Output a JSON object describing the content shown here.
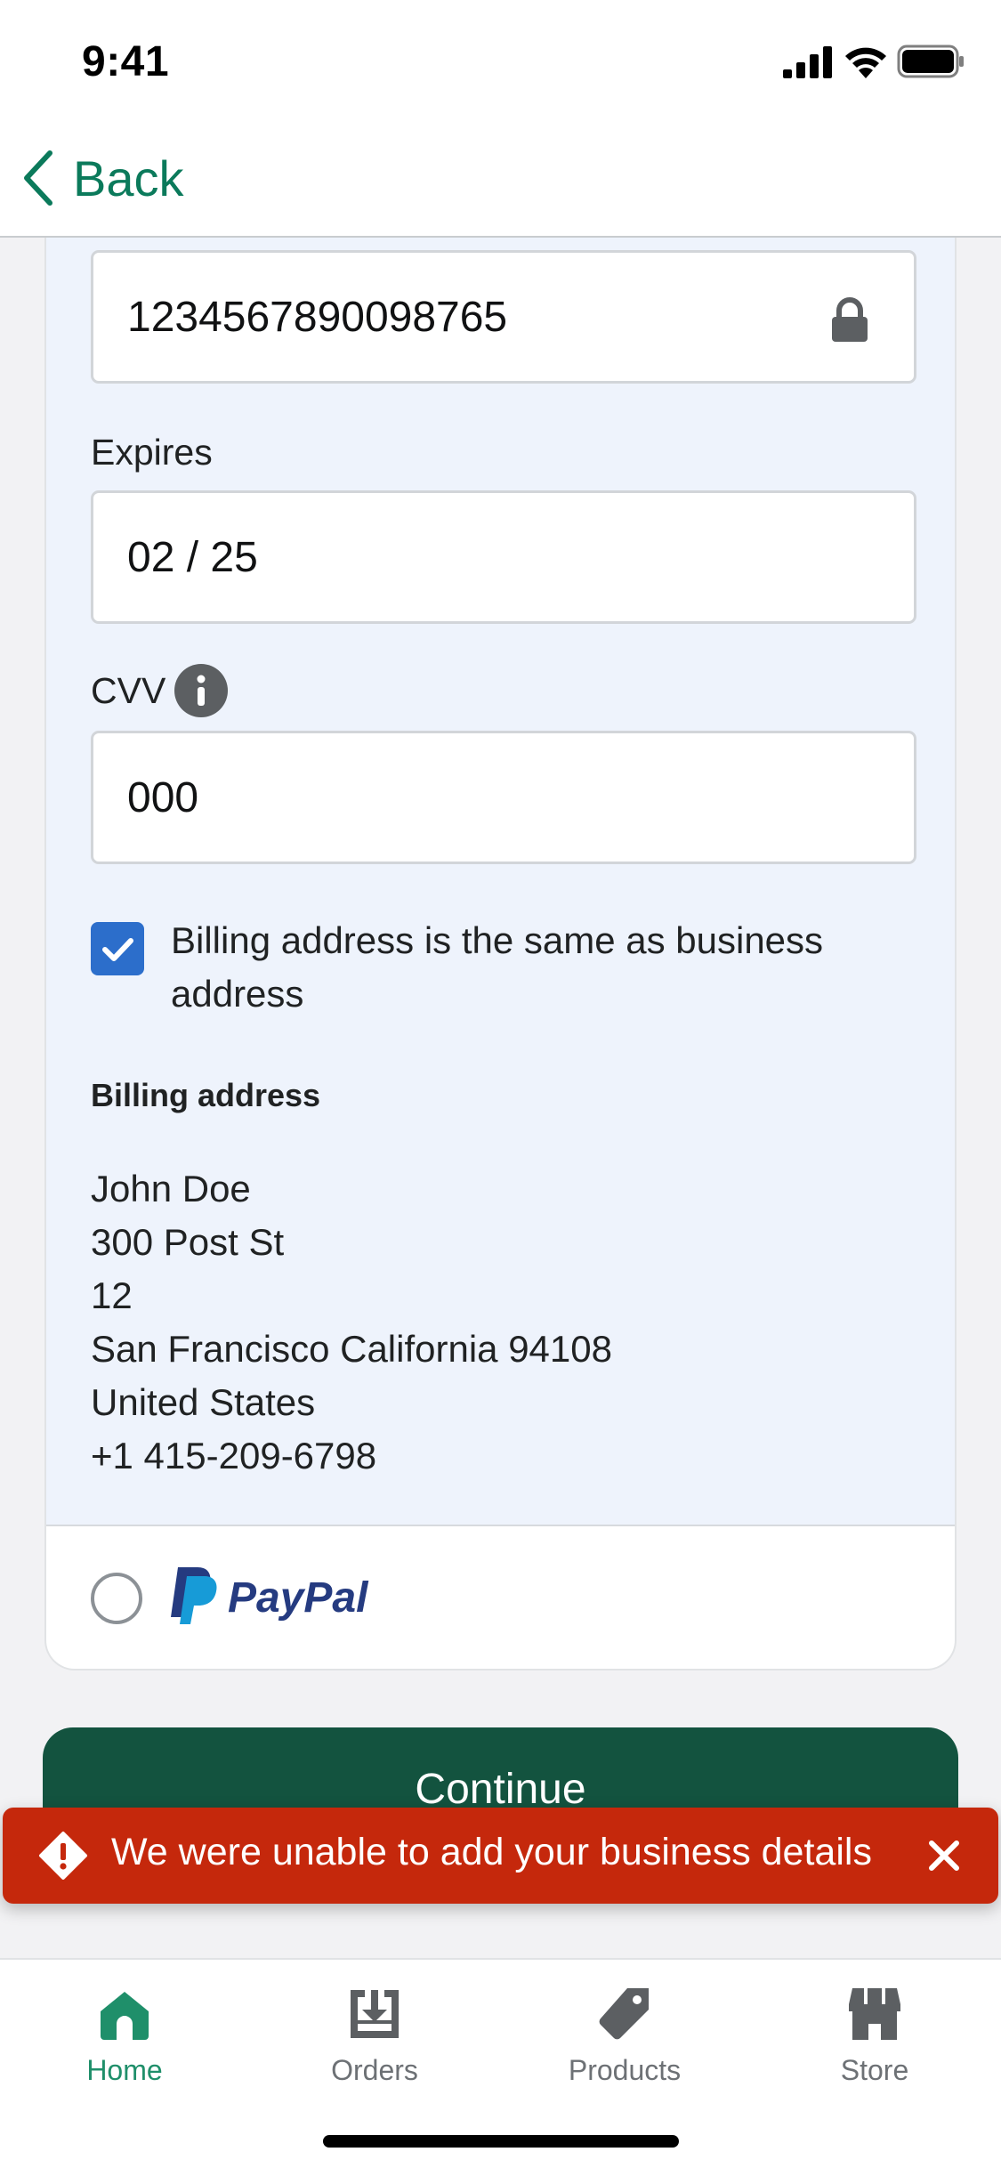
{
  "status_bar": {
    "time": "9:41"
  },
  "header": {
    "back_label": "Back"
  },
  "payment_form": {
    "card_number": {
      "value": "1234567890098765"
    },
    "expires": {
      "label": "Expires",
      "value": "02 / 25"
    },
    "cvv": {
      "label": "CVV",
      "value": "000"
    },
    "billing_same_checkbox": {
      "label": "Billing address is the same as business address",
      "checked": true
    },
    "billing_address": {
      "heading": "Billing address",
      "lines": [
        "John Doe",
        "300 Post St",
        "12",
        "San Francisco California 94108",
        "United States",
        "+1 415-209-6798"
      ]
    },
    "paypal_option": {
      "label": "PayPal",
      "selected": false
    }
  },
  "continue_button": {
    "label": "Continue"
  },
  "toast": {
    "message": "We were unable to add your business details"
  },
  "tab_bar": {
    "tabs": [
      {
        "label": "Home",
        "icon": "home-icon",
        "active": true
      },
      {
        "label": "Orders",
        "icon": "orders-icon",
        "active": false
      },
      {
        "label": "Products",
        "icon": "products-tag-icon",
        "active": false
      },
      {
        "label": "Store",
        "icon": "store-icon",
        "active": false
      }
    ]
  },
  "colors": {
    "accent_green": "#0B7A5B",
    "primary_button": "#13533F",
    "checkbox_blue": "#2C6ECB",
    "error_red": "#C5280C",
    "card_bg": "#EEF3FC"
  }
}
